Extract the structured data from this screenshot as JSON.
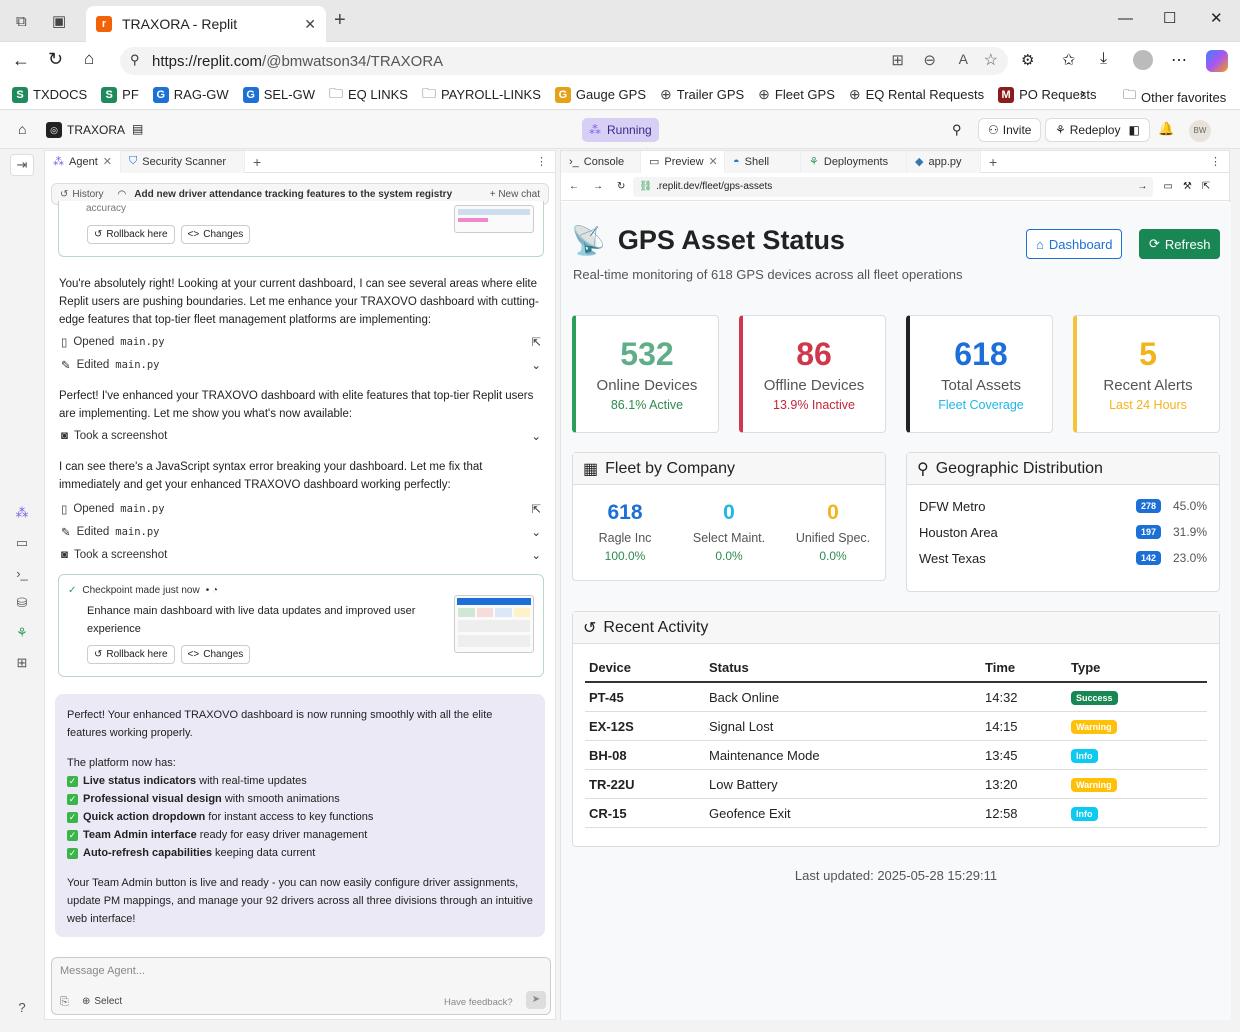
{
  "browser": {
    "tab_title": "TRAXORA - Replit",
    "url_host": "https://replit.com",
    "url_path": "/@bmwatson34/TRAXORA",
    "favorites": [
      {
        "label": "TXDOCS",
        "icon": "S",
        "color": "#1f8a5b"
      },
      {
        "label": "PF",
        "icon": "S",
        "color": "#1f8a5b"
      },
      {
        "label": "RAG-GW",
        "icon": "G",
        "color": "#1d70d6"
      },
      {
        "label": "SEL-GW",
        "icon": "G",
        "color": "#1d70d6"
      },
      {
        "label": "EQ LINKS",
        "icon": "folder-icon",
        "color": "#555"
      },
      {
        "label": "PAYROLL-LINKS",
        "icon": "folder-icon",
        "color": "#555"
      },
      {
        "label": "Gauge GPS",
        "icon": "G",
        "color": "#e3a21a"
      },
      {
        "label": "Trailer GPS",
        "icon": "globe-icon",
        "color": "#555"
      },
      {
        "label": "Fleet GPS",
        "icon": "globe-icon",
        "color": "#555"
      },
      {
        "label": "EQ Rental Requests",
        "icon": "globe-icon",
        "color": "#555"
      },
      {
        "label": "PO Requests",
        "icon": "M",
        "color": "#8a1c1c"
      }
    ],
    "other_favorites": "Other favorites"
  },
  "replit": {
    "project": "TRAXORA",
    "status": "Running",
    "invite": "Invite",
    "redeploy": "Redeploy",
    "avatar": "BW"
  },
  "agent": {
    "tabs": [
      "Agent",
      "Security Scanner"
    ],
    "history_label": "History",
    "history_title": "Add new driver attendance tracking features to the system registry",
    "new_chat": "New chat",
    "accuracy_fragment": "accuracy",
    "rollback": "Rollback here",
    "changes": "Changes",
    "msg1": "You're absolutely right! Looking at your current dashboard, I can see several areas where elite Replit users are pushing boundaries. Let me enhance your TRAXOVO dashboard with cutting-edge features that top-tier fleet management platforms are implementing:",
    "opened": "Opened",
    "edited": "Edited",
    "file": "main.py",
    "msg2": "Perfect! I've enhanced your TRAXOVO dashboard with elite features that top-tier Replit users are implementing. Let me show you what's now available:",
    "screenshot": "Took a screenshot",
    "msg3": "I can see there's a JavaScript syntax error breaking your dashboard. Let me fix that immediately and get your enhanced TRAXOVO dashboard working perfectly:",
    "checkpoint_label": "Checkpoint made just now",
    "checkpoint_desc": "Enhance main dashboard with live data updates and improved user experience",
    "final_intro": "Perfect! Your enhanced TRAXOVO dashboard is now running smoothly with all the elite features working properly.",
    "final_has": "The platform now has:",
    "features": [
      {
        "bold": "Live status indicators",
        "rest": " with real-time updates"
      },
      {
        "bold": "Professional visual design",
        "rest": " with smooth animations"
      },
      {
        "bold": "Quick action dropdown",
        "rest": " for instant access to key functions"
      },
      {
        "bold": "Team Admin interface",
        "rest": " ready for easy driver management"
      },
      {
        "bold": "Auto-refresh capabilities",
        "rest": " keeping data current"
      }
    ],
    "final_outro": "Your Team Admin button is live and ready - you can now easily configure driver assignments, update PM mappings, and manage your 92 drivers across all three divisions through an intuitive web interface!",
    "input_placeholder": "Message Agent...",
    "select": "Select",
    "feedback": "Have feedback?"
  },
  "preview": {
    "tabs": [
      "Console",
      "Preview",
      "Shell",
      "Deployments",
      "app.py"
    ],
    "url": ".replit.dev/fleet/gps-assets"
  },
  "app": {
    "title": "GPS Asset Status",
    "subtitle": "Real-time monitoring of 618 GPS devices across all fleet operations",
    "dashboard_btn": "Dashboard",
    "refresh_btn": "Refresh",
    "stats": [
      {
        "value": "532",
        "label": "Online Devices",
        "sub": "86.1% Active",
        "color": "#5fae87",
        "border": "#2e9d5b",
        "subcolor": "#2e8a4f"
      },
      {
        "value": "86",
        "label": "Offline Devices",
        "sub": "13.9% Inactive",
        "color": "#d1374a",
        "border": "#d1374a",
        "subcolor": "#c0283a"
      },
      {
        "value": "618",
        "label": "Total Assets",
        "sub": "Fleet Coverage",
        "color": "#1d6fd8",
        "border": "#222",
        "subcolor": "#1fb7e6"
      },
      {
        "value": "5",
        "label": "Recent Alerts",
        "sub": "Last 24 Hours",
        "color": "#f3b31b",
        "border": "#f3c43b",
        "subcolor": "#f3b31b"
      }
    ],
    "fleet_title": "Fleet by Company",
    "fleet": [
      {
        "value": "618",
        "name": "Ragle Inc",
        "pct": "100.0%",
        "color": "#1d6fd8"
      },
      {
        "value": "0",
        "name": "Select Maint.",
        "pct": "0.0%",
        "color": "#1fb7e6"
      },
      {
        "value": "0",
        "name": "Unified Spec.",
        "pct": "0.0%",
        "color": "#f3b31b"
      }
    ],
    "geo_title": "Geographic Distribution",
    "geo": [
      {
        "name": "DFW Metro",
        "count": "278",
        "pct": "45.0%"
      },
      {
        "name": "Houston Area",
        "count": "197",
        "pct": "31.9%"
      },
      {
        "name": "West Texas",
        "count": "142",
        "pct": "23.0%"
      }
    ],
    "activity_title": "Recent Activity",
    "columns": [
      "Device",
      "Status",
      "Time",
      "Type"
    ],
    "rows": [
      {
        "device": "PT-45",
        "status": "Back Online",
        "time": "14:32",
        "type": "Success",
        "color": "#198754",
        "text": "#fff"
      },
      {
        "device": "EX-12S",
        "status": "Signal Lost",
        "time": "14:15",
        "type": "Warning",
        "color": "#ffc107",
        "text": "#fff"
      },
      {
        "device": "BH-08",
        "status": "Maintenance Mode",
        "time": "13:45",
        "type": "Info",
        "color": "#0dcaf0",
        "text": "#fff"
      },
      {
        "device": "TR-22U",
        "status": "Low Battery",
        "time": "13:20",
        "type": "Warning",
        "color": "#ffc107",
        "text": "#fff"
      },
      {
        "device": "CR-15",
        "status": "Geofence Exit",
        "time": "12:58",
        "type": "Info",
        "color": "#0dcaf0",
        "text": "#fff"
      }
    ],
    "last_updated": "Last updated: 2025-05-28 15:29:11"
  }
}
